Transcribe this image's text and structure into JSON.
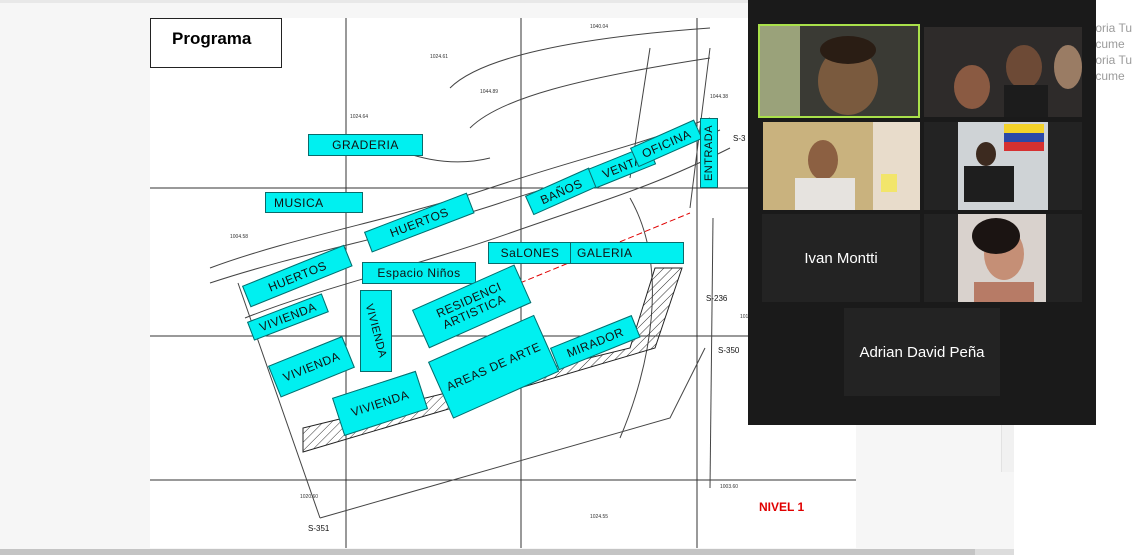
{
  "document": {
    "title": "Programa",
    "zones": [
      {
        "label": "GRADERIA"
      },
      {
        "label": "MUSICA"
      },
      {
        "label": "HUERTOS"
      },
      {
        "label": "HUERTOS"
      },
      {
        "label": "BAÑOS"
      },
      {
        "label": "VENTA"
      },
      {
        "label": "OFICINA"
      },
      {
        "label": "ENTRADA"
      },
      {
        "label": "SaLONES"
      },
      {
        "label": "GALERIA"
      },
      {
        "label": "Espacio Niños"
      },
      {
        "label": "VIVIENDA"
      },
      {
        "label": "VIVIENDA"
      },
      {
        "label": "VIVIENDA"
      },
      {
        "label": "VIVIENDA"
      },
      {
        "label": "RESIDENCI ARTISTICA"
      },
      {
        "label": "AREAS DE ARTE"
      },
      {
        "label": "MIRADOR"
      }
    ],
    "level_label": "NIVEL 1",
    "colors": {
      "zone_fill": "#00f0f0",
      "level_text": "#e00000"
    }
  },
  "right_panel": {
    "lines": [
      "ctoria Tu",
      "locume",
      "ctoria Tu",
      "locume"
    ]
  },
  "video_call": {
    "participants": [
      {
        "name": "",
        "video": true,
        "active_speaker": true
      },
      {
        "name": "",
        "video": true
      },
      {
        "name": "",
        "video": true
      },
      {
        "name": "",
        "video": true
      },
      {
        "name": "Ivan Montti",
        "video": false
      },
      {
        "name": "",
        "video": true
      },
      {
        "name": "Adrian David Peña",
        "video": false
      }
    ],
    "colors": {
      "active_border": "#a9e04a",
      "tile_bg": "#232323",
      "panel_bg": "#1a1a1a"
    }
  }
}
